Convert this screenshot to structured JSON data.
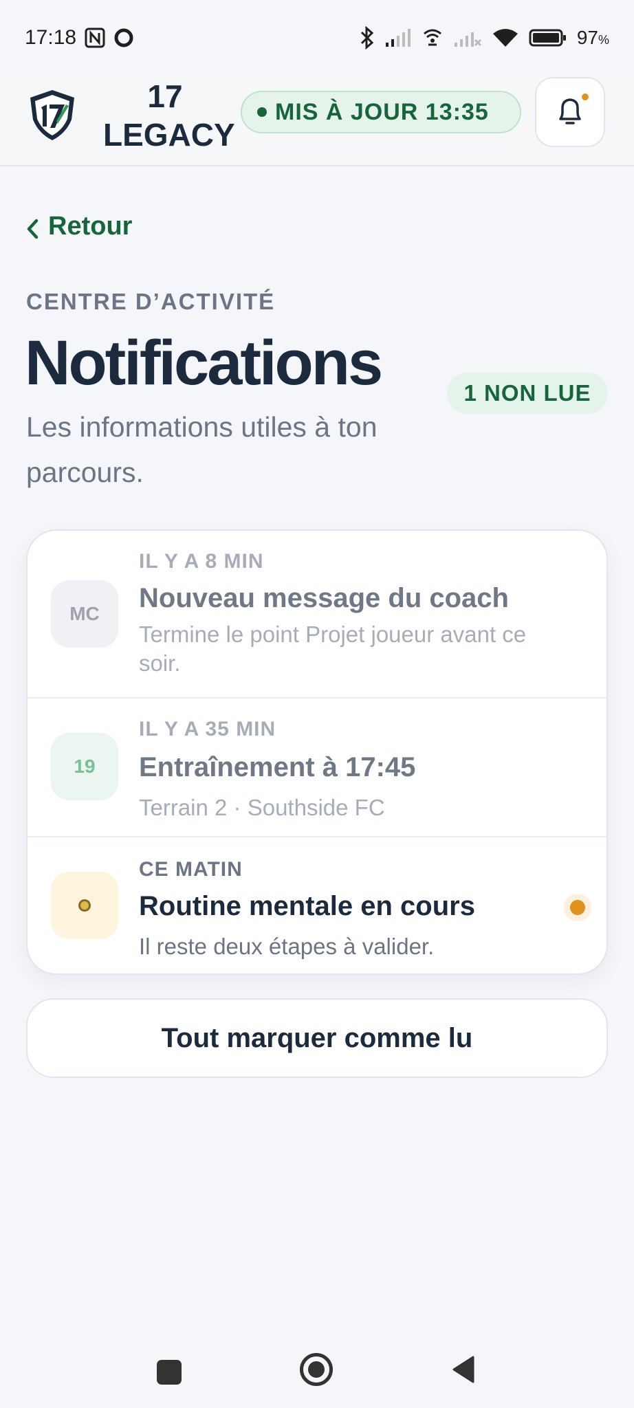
{
  "status_bar": {
    "time": "17:18",
    "battery": "97",
    "battery_unit": "%",
    "icons": [
      "nfc-icon",
      "circle-icon",
      "bluetooth-icon",
      "signal-icon",
      "hotspot-icon",
      "signal-no-service-icon",
      "wifi-icon",
      "battery-icon"
    ]
  },
  "header": {
    "brand_line1": "17",
    "brand_line2": "LEGACY",
    "update_label": "MIS À JOUR 13:35",
    "accent_color": "#17653a",
    "notification_dot_color": "#e0931c"
  },
  "nav": {
    "back_label": "Retour"
  },
  "page": {
    "eyebrow": "CENTRE D’ACTIVITÉ",
    "title": "Notifications",
    "unread_badge": "1 NON LUE",
    "subtitle": "Les informations utiles à ton parcours."
  },
  "notifications": [
    {
      "avatar": "MC",
      "time": "IL Y A 8 MIN",
      "title": "Nouveau message du coach",
      "body": "Termine le point Projet joueur avant ce soir.",
      "read": true
    },
    {
      "avatar": "19",
      "time": "IL Y A 35 MIN",
      "title": "Entraînement à 17:45",
      "body": "Terrain 2 · Southside FC",
      "read": true
    },
    {
      "avatar": "",
      "time": "CE MATIN",
      "title": "Routine mentale en cours",
      "body": "Il reste deux étapes à valider.",
      "read": false
    }
  ],
  "actions": {
    "mark_all_read": "Tout marquer comme lu"
  },
  "system_nav": {
    "icons": [
      "recent-apps-icon",
      "home-icon",
      "back-icon"
    ]
  }
}
